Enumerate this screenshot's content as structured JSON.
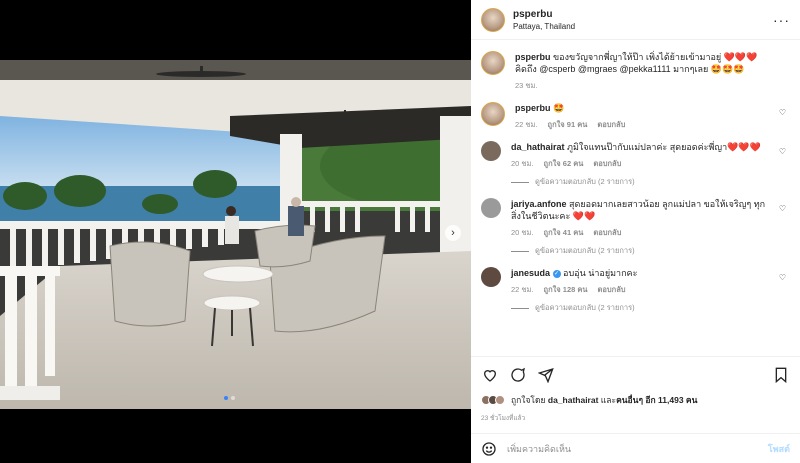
{
  "post": {
    "username": "psperbu",
    "location": "Pattaya, Thailand"
  },
  "caption": {
    "username": "psperbu",
    "text": "ของขวัญจากพี่ญาให้ป๊า เพิ่งได้ย้ายเข้ามาอยู่ ❤️❤️❤️ คิดถึง @csperb @mgraes @pekka1111 มากๆเลย 🤩🤩🤩",
    "time": "23 ชม."
  },
  "comments": [
    {
      "username": "psperbu",
      "text": "🤩",
      "time": "22 ชม.",
      "likes": "ถูกใจ 91 คน",
      "reply": "ตอบกลับ",
      "verified": false,
      "avatar_color": "#c8a98e"
    },
    {
      "username": "da_hathairat",
      "text": "ภูมิใจแทนป๊ากับแม่ปลาค่ะ สุดยอดค่ะพี่ญา❤️❤️❤️",
      "time": "20 ชม.",
      "likes": "ถูกใจ 62 คน",
      "reply": "ตอบกลับ",
      "verified": false,
      "avatar_color": "#7a6a5e"
    },
    {
      "username": "jariya.anfone",
      "text": "สุดยอดมากเลยสาวน้อย ลูกแม่ปลา ขอให้เจริญๆ ทุกสิ่งในชีวิตนะคะ ❤️❤️",
      "time": "20 ชม.",
      "likes": "ถูกใจ 41 คน",
      "reply": "ตอบกลับ",
      "verified": false,
      "avatar_color": "#9a9a9a"
    },
    {
      "username": "janesuda",
      "text": "อบอุ่น น่าอยู่มากคะ",
      "time": "22 ชม.",
      "likes": "ถูกใจ 128 คน",
      "reply": "ตอบกลับ",
      "verified": true,
      "avatar_color": "#5e4a40"
    }
  ],
  "view_replies": [
    "ดูข้อความตอบกลับ (2 รายการ)",
    "ดูข้อความตอบกลับ (2 รายการ)",
    "ดูข้อความตอบกลับ (2 รายการ)"
  ],
  "likes_summary": {
    "prefix": "ถูกใจโดย",
    "user": "da_hathairat",
    "middle": "และ",
    "others": "คนอื่นๆ อีก 11,493 คน"
  },
  "posted_time": "23 ชั่วโมงที่แล้ว",
  "add_comment": {
    "placeholder": "เพิ่มความคิดเห็น",
    "post_label": "โพสต์"
  },
  "icons": {
    "more": "more-options-icon",
    "like": "heart-icon",
    "comment": "comment-icon",
    "share": "share-icon",
    "save": "bookmark-icon",
    "emoji": "emoji-icon",
    "next": "chevron-right-icon"
  },
  "carousel": {
    "count": 2,
    "active_index": 0
  },
  "colors": {
    "accent": "#3897f0",
    "post_disabled": "#b3dbff",
    "muted": "#8e8e8e"
  }
}
